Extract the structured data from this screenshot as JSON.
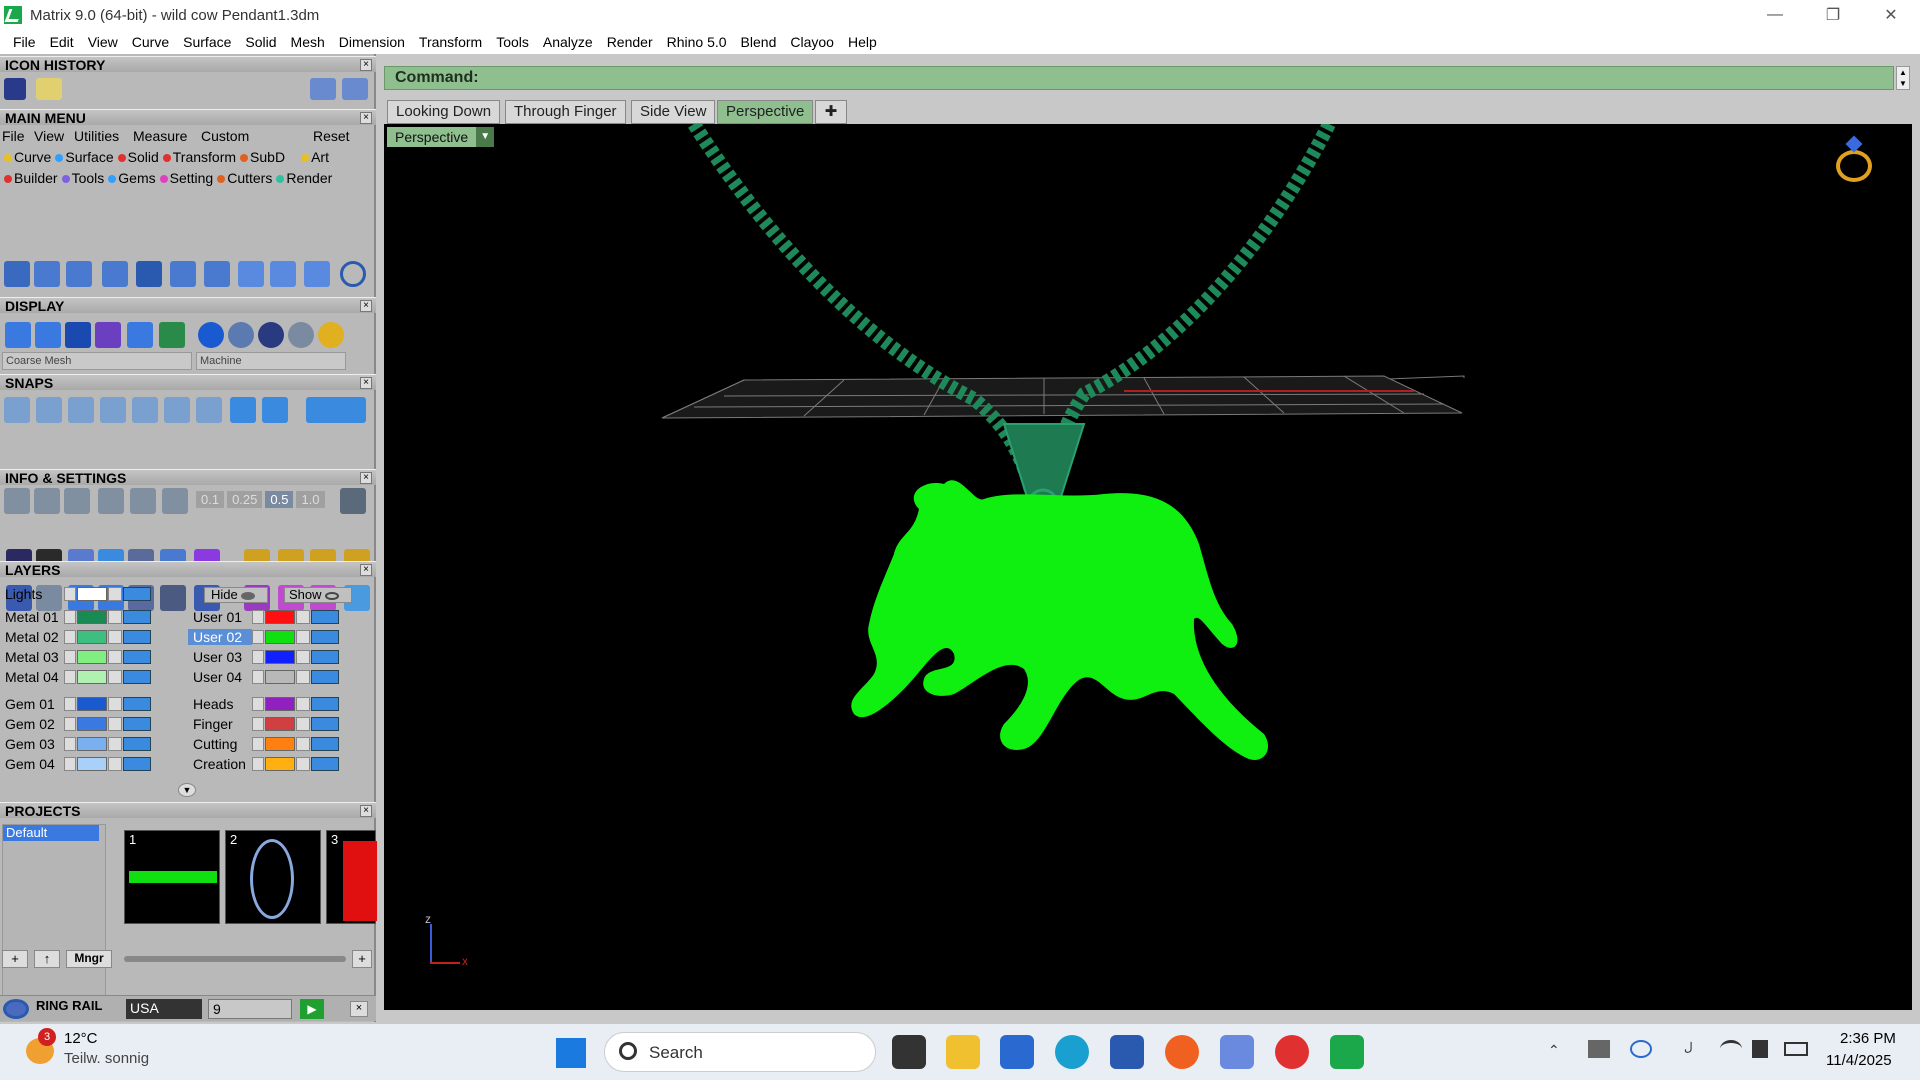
{
  "window": {
    "title": "Matrix 9.0 (64-bit) - wild cow Pendant1.3dm"
  },
  "menubar": [
    "File",
    "Edit",
    "View",
    "Curve",
    "Surface",
    "Solid",
    "Mesh",
    "Dimension",
    "Transform",
    "Tools",
    "Analyze",
    "Render",
    "Rhino 5.0",
    "Blend",
    "Clayoo",
    "Help"
  ],
  "panels": {
    "icon_history": "ICON HISTORY",
    "main_menu": "MAIN MENU",
    "display": "DISPLAY",
    "snaps": "SNAPS",
    "info_settings": "INFO & SETTINGS",
    "layers": "LAYERS",
    "projects": "PROJECTS",
    "ring_rail": "RING RAIL"
  },
  "main_menu": {
    "top": [
      "File",
      "View",
      "Utilities",
      "Measure",
      "Custom"
    ],
    "reset": "Reset",
    "row1": [
      {
        "label": "Curve",
        "color": "#e8c020"
      },
      {
        "label": "Surface",
        "color": "#30a0ff"
      },
      {
        "label": "Solid",
        "color": "#e03030"
      },
      {
        "label": "Transform",
        "color": "#e03030"
      },
      {
        "label": "SubD",
        "color": "#e06020"
      },
      {
        "label": "Art",
        "color": "#e8c020"
      }
    ],
    "row2": [
      {
        "label": "Builder",
        "color": "#e03030"
      },
      {
        "label": "Tools",
        "color": "#8060e0"
      },
      {
        "label": "Gems",
        "color": "#30a0ff"
      },
      {
        "label": "Setting",
        "color": "#e040c0"
      },
      {
        "label": "Cutters",
        "color": "#e06020"
      },
      {
        "label": "Render",
        "color": "#30c0a0"
      }
    ]
  },
  "display": {
    "mesh_combo": "Coarse Mesh",
    "material_combo": "Machine"
  },
  "snaps": {
    "increments": [
      "0.1",
      "0.25",
      "0.5",
      "1.0"
    ]
  },
  "layers": {
    "lights": "Lights",
    "hide": "Hide",
    "show": "Show",
    "left": [
      {
        "name": "Metal 01",
        "color": "#1a8a55"
      },
      {
        "name": "Metal 02",
        "color": "#3fbf7f"
      },
      {
        "name": "Metal 03",
        "color": "#80ee80"
      },
      {
        "name": "Metal 04",
        "color": "#b0f0b0"
      },
      {
        "name": "Gem 01",
        "color": "#1a5ad0"
      },
      {
        "name": "Gem 02",
        "color": "#3a7ae0"
      },
      {
        "name": "Gem 03",
        "color": "#7ab0f0"
      },
      {
        "name": "Gem 04",
        "color": "#a8d0f8"
      }
    ],
    "right": [
      {
        "name": "User 01",
        "color": "#ff1010",
        "selected": false
      },
      {
        "name": "User 02",
        "color": "#10e010",
        "selected": true
      },
      {
        "name": "User 03",
        "color": "#1020ff",
        "selected": false
      },
      {
        "name": "User 04",
        "color": "#b8b8b8",
        "selected": false
      },
      {
        "name": "Heads",
        "color": "#9020c0",
        "selected": false
      },
      {
        "name": "Finger",
        "color": "#d04040",
        "selected": false
      },
      {
        "name": "Cutting",
        "color": "#ff8010",
        "selected": false
      },
      {
        "name": "Creation",
        "color": "#ffb010",
        "selected": false
      }
    ]
  },
  "projects": {
    "list": [
      "Default"
    ],
    "slots": [
      "1",
      "2",
      "3"
    ],
    "mngr": "Mngr"
  },
  "ring_rail": {
    "standard": "USA",
    "size": "9"
  },
  "command": {
    "label": "Command:"
  },
  "tabs": [
    "Looking Down",
    "Through Finger",
    "Side View",
    "Perspective"
  ],
  "active_tab": "Perspective",
  "viewport": {
    "label": "Perspective",
    "axis_z": "z",
    "axis_x": "x"
  },
  "taskbar": {
    "weather_temp": "12°C",
    "weather_text": "Teilw. sonnig",
    "weather_badge": "3",
    "search": "Search",
    "time": "2:36 PM",
    "date": "11/4/2025"
  }
}
